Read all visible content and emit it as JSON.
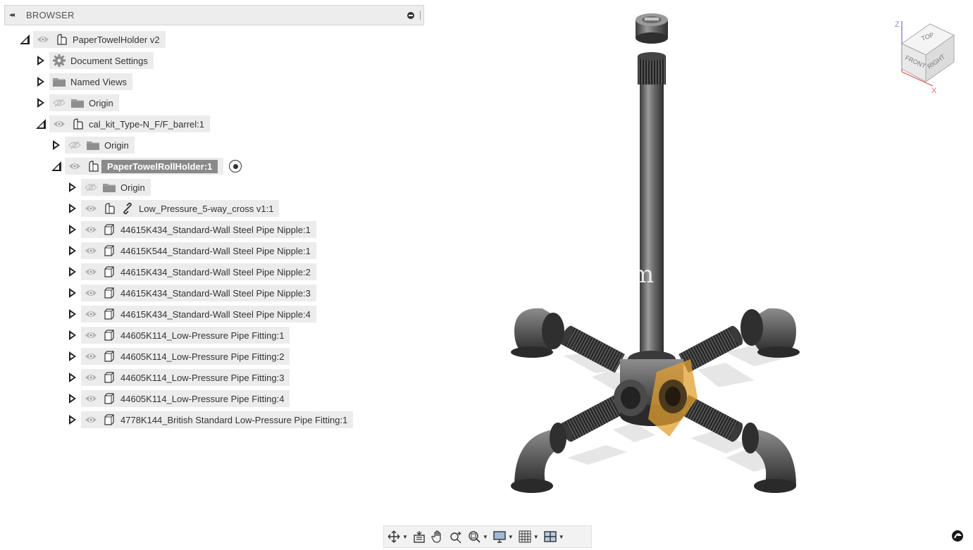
{
  "browser": {
    "title": "BROWSER",
    "collapse_glyph": "◂◂"
  },
  "tree": [
    {
      "level": 0,
      "state": "open",
      "eye": "visible",
      "icons": [
        "component-icon"
      ],
      "label": "PaperTowelHolder v2"
    },
    {
      "level": 1,
      "state": "closed",
      "eye": "none",
      "icons": [
        "gear-icon"
      ],
      "label": "Document Settings"
    },
    {
      "level": 1,
      "state": "closed",
      "eye": "none",
      "icons": [
        "folder-icon"
      ],
      "label": "Named Views"
    },
    {
      "level": 1,
      "state": "closed",
      "eye": "hidden",
      "icons": [
        "folder-icon"
      ],
      "label": "Origin"
    },
    {
      "level": 1,
      "state": "open",
      "eye": "visible",
      "icons": [
        "component-icon"
      ],
      "label": "cal_kit_Type-N_F/F_barrel:1"
    },
    {
      "level": 2,
      "state": "closed",
      "eye": "hidden",
      "icons": [
        "folder-icon"
      ],
      "label": "Origin"
    },
    {
      "level": 2,
      "state": "open",
      "eye": "visible",
      "icons": [
        "component-icon"
      ],
      "label": "PaperTowelRollHolder:1",
      "selected": true,
      "active": true
    },
    {
      "level": 3,
      "state": "closed",
      "eye": "hidden",
      "icons": [
        "folder-icon"
      ],
      "label": "Origin"
    },
    {
      "level": 3,
      "state": "closed",
      "eye": "visible",
      "icons": [
        "component-icon",
        "link-icon"
      ],
      "label": "Low_Pressure_5-way_cross v1:1"
    },
    {
      "level": 3,
      "state": "closed",
      "eye": "visible",
      "icons": [
        "body-icon"
      ],
      "label": "44615K434_Standard-Wall Steel Pipe Nipple:1"
    },
    {
      "level": 3,
      "state": "closed",
      "eye": "visible",
      "icons": [
        "body-icon"
      ],
      "label": "44615K544_Standard-Wall Steel Pipe Nipple:1"
    },
    {
      "level": 3,
      "state": "closed",
      "eye": "visible",
      "icons": [
        "body-icon"
      ],
      "label": "44615K434_Standard-Wall Steel Pipe Nipple:2"
    },
    {
      "level": 3,
      "state": "closed",
      "eye": "visible",
      "icons": [
        "body-icon"
      ],
      "label": "44615K434_Standard-Wall Steel Pipe Nipple:3"
    },
    {
      "level": 3,
      "state": "closed",
      "eye": "visible",
      "icons": [
        "body-icon"
      ],
      "label": "44615K434_Standard-Wall Steel Pipe Nipple:4"
    },
    {
      "level": 3,
      "state": "closed",
      "eye": "visible",
      "icons": [
        "body-icon"
      ],
      "label": "44605K114_Low-Pressure Pipe Fitting:1"
    },
    {
      "level": 3,
      "state": "closed",
      "eye": "visible",
      "icons": [
        "body-icon"
      ],
      "label": "44605K114_Low-Pressure Pipe Fitting:2"
    },
    {
      "level": 3,
      "state": "closed",
      "eye": "visible",
      "icons": [
        "body-icon"
      ],
      "label": "44605K114_Low-Pressure Pipe Fitting:3"
    },
    {
      "level": 3,
      "state": "closed",
      "eye": "visible",
      "icons": [
        "body-icon"
      ],
      "label": "44605K114_Low-Pressure Pipe Fitting:4"
    },
    {
      "level": 3,
      "state": "closed",
      "eye": "visible",
      "icons": [
        "body-icon"
      ],
      "label": "4778K144_British Standard Low-Pressure Pipe Fitting:1"
    }
  ],
  "viewport": {
    "watermark": "m",
    "selection_color": "#e0a030"
  },
  "viewcube": {
    "faces": {
      "top": "TOP",
      "front": "FRONT",
      "right": "RIGHT"
    },
    "axes": {
      "z": "Z",
      "x": "X"
    }
  },
  "nav_toolbar": {
    "tools": [
      "orbit-icon",
      "look-at-icon",
      "pan-icon",
      "zoom-icon",
      "fit-icon",
      "display-settings-icon",
      "grid-icon",
      "viewports-icon"
    ]
  }
}
